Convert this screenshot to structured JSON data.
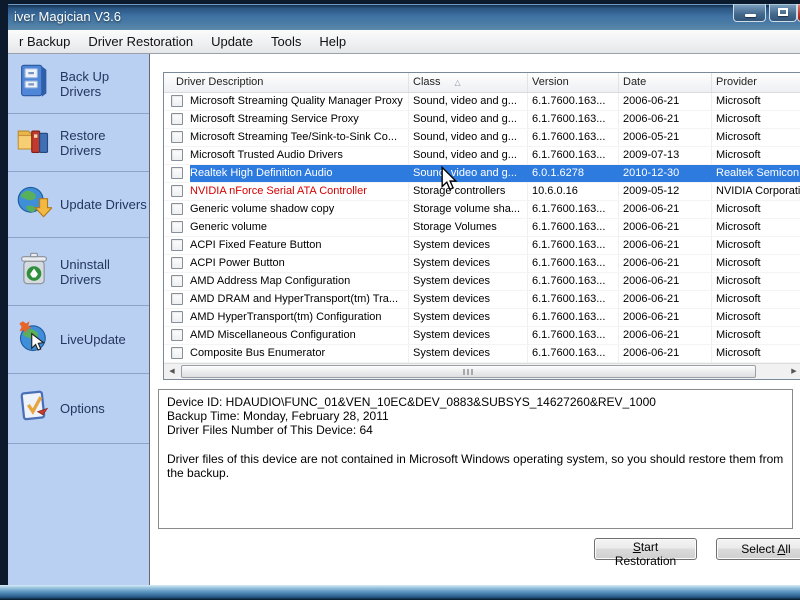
{
  "window": {
    "title": "iver Magician V3.6"
  },
  "menu": {
    "items": [
      "r Backup",
      "Driver Restoration",
      "Update",
      "Tools",
      "Help"
    ]
  },
  "sidebar": {
    "items": [
      {
        "label": "Back Up Drivers",
        "icon": "backup-cabinet-icon"
      },
      {
        "label": "Restore Drivers",
        "icon": "restore-folder-icon"
      },
      {
        "label": "Update Drivers",
        "icon": "update-globe-icon"
      },
      {
        "label": "Uninstall Drivers",
        "icon": "uninstall-trash-icon"
      },
      {
        "label": "LiveUpdate",
        "icon": "liveupdate-globe-icon"
      },
      {
        "label": "Options",
        "icon": "options-check-icon"
      }
    ]
  },
  "table": {
    "columns": [
      "Driver Description",
      "Class",
      "Version",
      "Date",
      "Provider"
    ],
    "sorted_column": "Class",
    "sort_glyph": "△",
    "rows": [
      {
        "desc": "Microsoft Streaming Quality Manager Proxy",
        "cls": "Sound, video and g...",
        "version": "6.1.7600.163...",
        "date": "2006-06-21",
        "provider": "Microsoft",
        "checked": false,
        "selected": false,
        "red": false
      },
      {
        "desc": "Microsoft Streaming Service Proxy",
        "cls": "Sound, video and g...",
        "version": "6.1.7600.163...",
        "date": "2006-06-21",
        "provider": "Microsoft",
        "checked": false,
        "selected": false,
        "red": false
      },
      {
        "desc": "Microsoft Streaming Tee/Sink-to-Sink Co...",
        "cls": "Sound, video and g...",
        "version": "6.1.7600.163...",
        "date": "2006-05-21",
        "provider": "Microsoft",
        "checked": false,
        "selected": false,
        "red": false
      },
      {
        "desc": "Microsoft Trusted Audio Drivers",
        "cls": "Sound, video and g...",
        "version": "6.1.7600.163...",
        "date": "2009-07-13",
        "provider": "Microsoft",
        "checked": false,
        "selected": false,
        "red": false
      },
      {
        "desc": "Realtek High Definition Audio",
        "cls": "Sound, video and g...",
        "version": "6.0.1.6278",
        "date": "2010-12-30",
        "provider": "Realtek Semicon",
        "checked": false,
        "selected": true,
        "red": false
      },
      {
        "desc": "NVIDIA nForce Serial ATA Controller",
        "cls": "Storage controllers",
        "version": "10.6.0.16",
        "date": "2009-05-12",
        "provider": "NVIDIA Corporati",
        "checked": false,
        "selected": false,
        "red": true
      },
      {
        "desc": "Generic volume shadow copy",
        "cls": "Storage volume sha...",
        "version": "6.1.7600.163...",
        "date": "2006-06-21",
        "provider": "Microsoft",
        "checked": false,
        "selected": false,
        "red": false
      },
      {
        "desc": "Generic volume",
        "cls": "Storage Volumes",
        "version": "6.1.7600.163...",
        "date": "2006-06-21",
        "provider": "Microsoft",
        "checked": false,
        "selected": false,
        "red": false
      },
      {
        "desc": "ACPI Fixed Feature Button",
        "cls": "System devices",
        "version": "6.1.7600.163...",
        "date": "2006-06-21",
        "provider": "Microsoft",
        "checked": false,
        "selected": false,
        "red": false
      },
      {
        "desc": "ACPI Power Button",
        "cls": "System devices",
        "version": "6.1.7600.163...",
        "date": "2006-06-21",
        "provider": "Microsoft",
        "checked": false,
        "selected": false,
        "red": false
      },
      {
        "desc": "AMD Address Map Configuration",
        "cls": "System devices",
        "version": "6.1.7600.163...",
        "date": "2006-06-21",
        "provider": "Microsoft",
        "checked": false,
        "selected": false,
        "red": false
      },
      {
        "desc": "AMD DRAM and HyperTransport(tm) Tra...",
        "cls": "System devices",
        "version": "6.1.7600.163...",
        "date": "2006-06-21",
        "provider": "Microsoft",
        "checked": false,
        "selected": false,
        "red": false
      },
      {
        "desc": "AMD HyperTransport(tm) Configuration",
        "cls": "System devices",
        "version": "6.1.7600.163...",
        "date": "2006-06-21",
        "provider": "Microsoft",
        "checked": false,
        "selected": false,
        "red": false
      },
      {
        "desc": "AMD Miscellaneous Configuration",
        "cls": "System devices",
        "version": "6.1.7600.163...",
        "date": "2006-06-21",
        "provider": "Microsoft",
        "checked": false,
        "selected": false,
        "red": false
      },
      {
        "desc": "Composite Bus Enumerator",
        "cls": "System devices",
        "version": "6.1.7600.163...",
        "date": "2006-06-21",
        "provider": "Microsoft",
        "checked": false,
        "selected": false,
        "red": false
      }
    ]
  },
  "details": {
    "device_id": "Device ID: HDAUDIO\\FUNC_01&VEN_10EC&DEV_0883&SUBSYS_14627260&REV_1000",
    "backup_time": "Backup Time: Monday, February 28, 2011",
    "files_number": "Driver Files Number of This Device: 64",
    "note": "Driver files of this device are not contained in Microsoft Windows operating system, so you should restore them from the backup."
  },
  "buttons": {
    "start_restoration": {
      "label": "Start Restoration",
      "underline_index": 0
    },
    "select_all": {
      "label": "Select All",
      "underline_index": 7
    }
  },
  "colors": {
    "selection_blue": "#2e7be0",
    "alert_red": "#d40000",
    "sidebar_blue": "#b9d0f2",
    "titlebar_blue": "#3f72a3"
  }
}
